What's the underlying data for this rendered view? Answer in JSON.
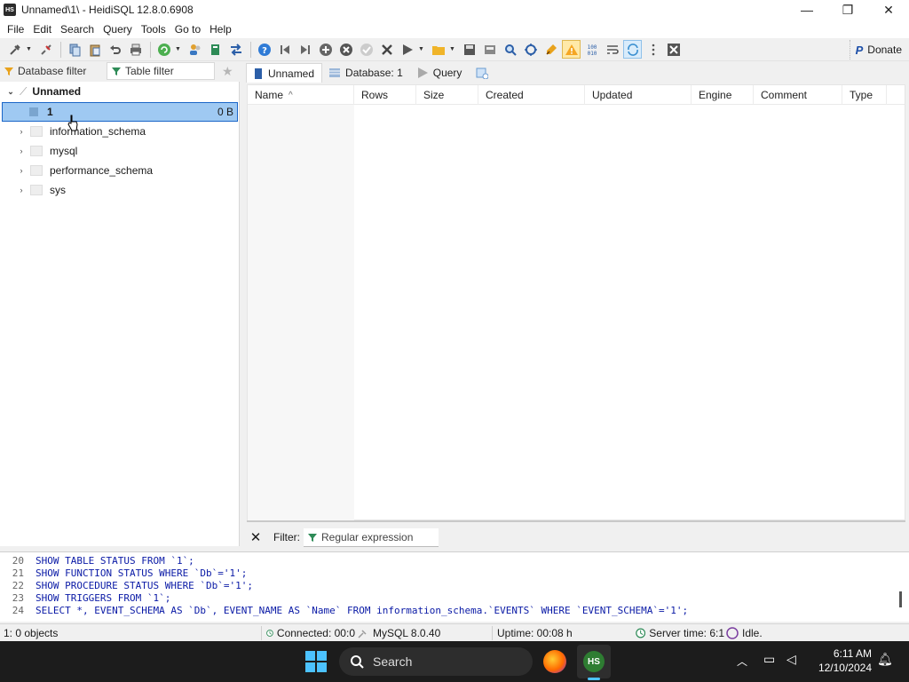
{
  "window": {
    "app_icon_text": "HS",
    "title": "Unnamed\\1\\ - HeidiSQL 12.8.0.6908",
    "minimize": "—",
    "maximize": "❐",
    "close": "✕"
  },
  "menu": [
    "File",
    "Edit",
    "Search",
    "Query",
    "Tools",
    "Go to",
    "Help"
  ],
  "toolbar": {
    "donate_label": "Donate"
  },
  "left_pane": {
    "database_filter_label": "Database filter",
    "table_filter_label": "Table filter",
    "tree": {
      "root_label": "Unnamed",
      "selected": {
        "label": "1",
        "size": "0 B"
      },
      "items": [
        "information_schema",
        "mysql",
        "performance_schema",
        "sys"
      ]
    }
  },
  "main_tabs": [
    "Unnamed",
    "Database: 1",
    "Query"
  ],
  "grid": {
    "columns": [
      "Name",
      "Rows",
      "Size",
      "Created",
      "Updated",
      "Engine",
      "Comment",
      "Type"
    ],
    "sort_indicator": "^"
  },
  "filter_bar": {
    "label": "Filter:",
    "placeholder": "Regular expression"
  },
  "sql_log": [
    {
      "n": "20",
      "sql": "SHOW TABLE STATUS FROM `1`;"
    },
    {
      "n": "21",
      "sql": "SHOW FUNCTION STATUS WHERE `Db`='1';"
    },
    {
      "n": "22",
      "sql": "SHOW PROCEDURE STATUS WHERE `Db`='1';"
    },
    {
      "n": "23",
      "sql": "SHOW TRIGGERS FROM `1`;"
    },
    {
      "n": "24",
      "sql": "SELECT *, EVENT_SCHEMA AS `Db`, EVENT_NAME AS `Name` FROM information_schema.`EVENTS` WHERE `EVENT_SCHEMA`='1';"
    }
  ],
  "status_bar": {
    "objects": "1: 0 objects",
    "connected": "Connected: 00:0",
    "server_version": "MySQL 8.0.40",
    "uptime": "Uptime: 00:08 h",
    "server_time": "Server time: 6:1",
    "state": "Idle."
  },
  "taskbar": {
    "search_label": "Search",
    "heidi_icon_text": "HS",
    "time": "6:11 AM",
    "date": "12/10/2024"
  },
  "colors": {
    "selection_fill": "#9fc9f2",
    "selection_border": "#1b66c8",
    "sql_keyword": "#0a1aa6",
    "taskbar": "#1c1c1c"
  }
}
